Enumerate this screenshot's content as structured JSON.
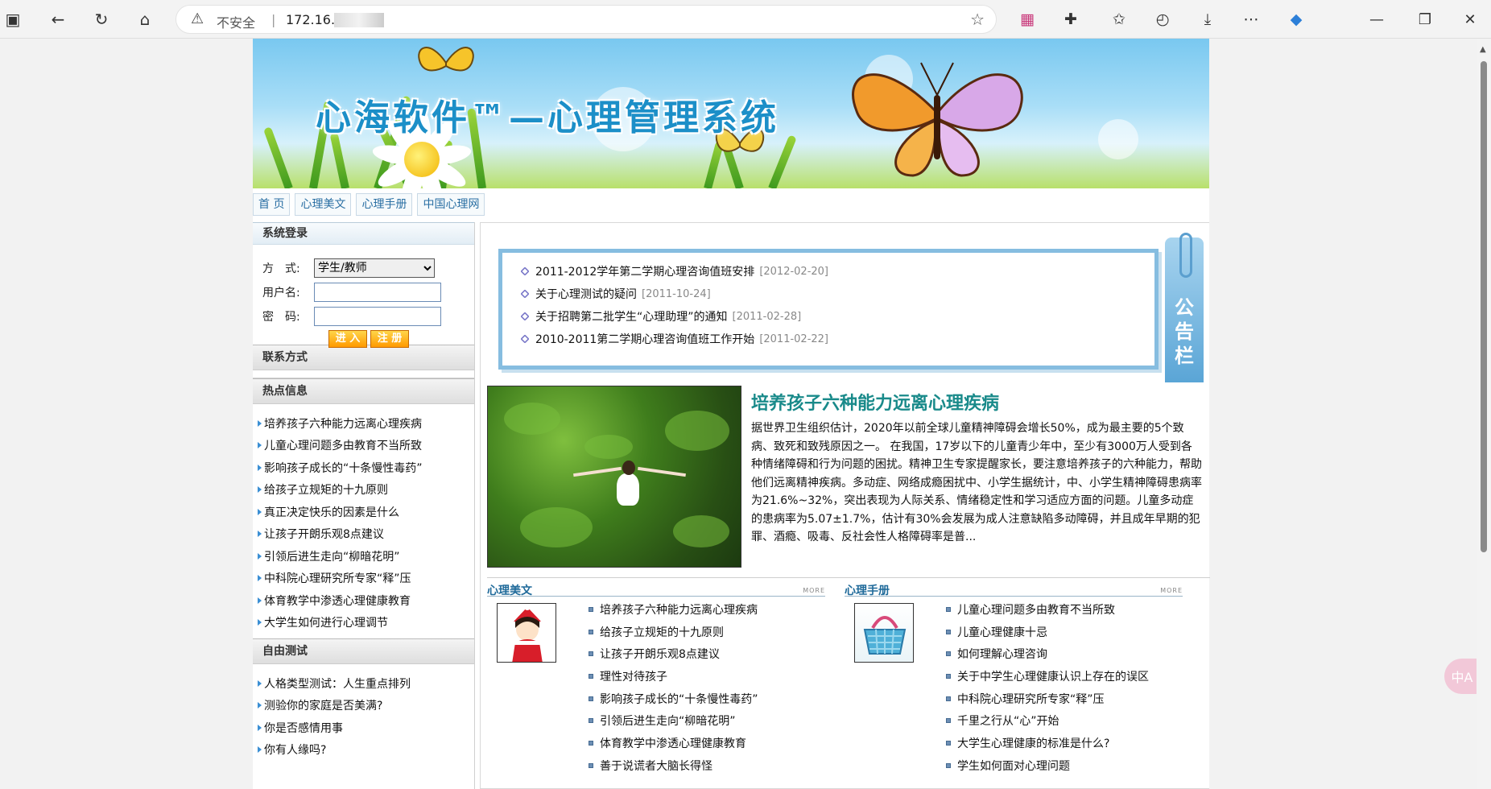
{
  "browser": {
    "security_label": "不安全",
    "url": "172.16."
  },
  "banner": {
    "title": "心海软件™—心理管理系统"
  },
  "topnav": [
    "首 页",
    "心理美文",
    "心理手册",
    "中国心理网"
  ],
  "login": {
    "heading": "系统登录",
    "mode_label": "方　式:",
    "mode_value": "学生/教师",
    "username_label": "用户名:",
    "password_label": "密　码:",
    "enter_button": "进 入",
    "register_button": "注 册"
  },
  "contact": {
    "heading": "联系方式"
  },
  "hot": {
    "heading": "热点信息",
    "items": [
      "培养孩子六种能力远离心理疾病",
      "儿童心理问题多由教育不当所致",
      "影响孩子成长的“十条慢性毒药”",
      "给孩子立规矩的十九原则",
      "真正决定快乐的因素是什么",
      "让孩子开朗乐观8点建议",
      "引领后进生走向“柳暗花明”",
      "中科院心理研究所专家“释”压",
      "体育教学中渗透心理健康教育",
      "大学生如何进行心理调节"
    ]
  },
  "freetest": {
    "heading": "自由测试",
    "items": [
      "人格类型测试：人生重点排列",
      "测验你的家庭是否美满?",
      "你是否感情用事",
      "你有人缘吗?"
    ]
  },
  "notice": {
    "tab_chars": [
      "公",
      "告",
      "栏"
    ],
    "items": [
      {
        "title": "2011-2012学年第二学期心理咨询值班安排",
        "date": "[2012-02-20]"
      },
      {
        "title": "关于心理测试的疑问",
        "date": "[2011-10-24]"
      },
      {
        "title": "关于招聘第二批学生“心理助理”的通知",
        "date": "[2011-02-28]"
      },
      {
        "title": "2010-2011第二学期心理咨询值班工作开始",
        "date": "[2011-02-22]"
      }
    ]
  },
  "feature": {
    "title": "培养孩子六种能力远离心理疾病",
    "text": "据世界卫生组织估计，2020年以前全球儿童精神障碍会增长50%，成为最主要的5个致病、致死和致残原因之一。 在我国，17岁以下的儿童青少年中，至少有3000万人受到各种情绪障碍和行为问题的困扰。精神卫生专家提醒家长，要注意培养孩子的六种能力，帮助他们远离精神疾病。多动症、网络成瘾困扰中、小学生据统计，中、小学生精神障碍患病率为21.6%~32%，突出表现为人际关系、情绪稳定性和学习适应方面的问题。儿童多动症的患病率为5.07±1.7%，估计有30%会发展为成人注意缺陷多动障碍，并且成年早期的犯罪、酒瘾、吸毒、反社会性人格障碍率是普..."
  },
  "articles": {
    "heading": "心理美文",
    "more": "MORE",
    "items": [
      "培养孩子六种能力远离心理疾病",
      "给孩子立规矩的十九原则",
      "让孩子开朗乐观8点建议",
      "理性对待孩子",
      "影响孩子成长的“十条慢性毒药”",
      "引领后进生走向“柳暗花明”",
      "体育教学中渗透心理健康教育",
      "善于说谎者大脑长得怪"
    ]
  },
  "handbook": {
    "heading": "心理手册",
    "more": "MORE",
    "items": [
      "儿童心理问题多由教育不当所致",
      "儿童心理健康十忌",
      "如何理解心理咨询",
      "关于中学生心理健康认识上存在的误区",
      "中科院心理研究所专家“释”压",
      "千里之行从“心”开始",
      "大学生心理健康的标准是什么?",
      "学生如何面对心理问题"
    ]
  },
  "colors": {
    "link_blue": "#2a6fa3",
    "feature_title": "#198a8a",
    "notice_border": "#86bde0"
  }
}
